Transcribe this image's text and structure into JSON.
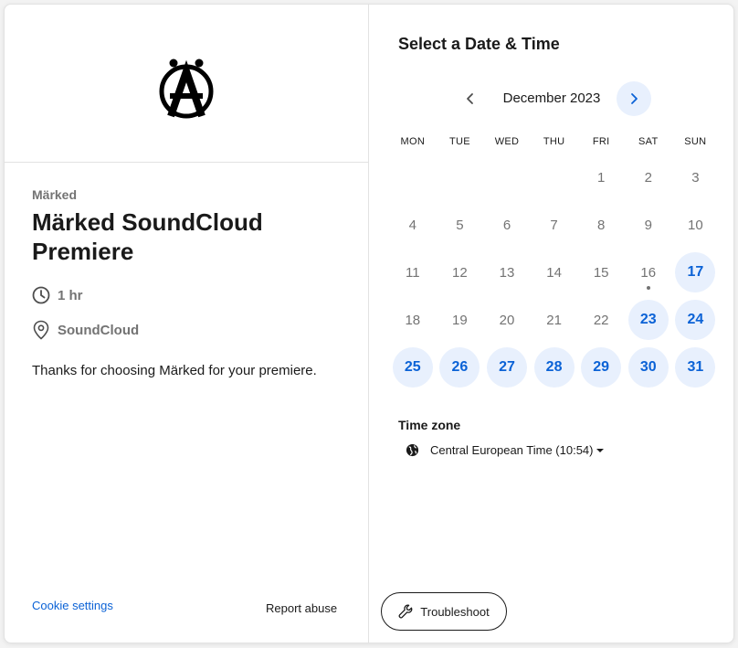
{
  "event": {
    "organizer": "Märked",
    "title": "Märked SoundCloud Premiere",
    "duration": "1 hr",
    "location": "SoundCloud",
    "description": "Thanks for choosing Märked for your premiere."
  },
  "footer": {
    "cookie_settings": "Cookie settings",
    "report_abuse": "Report abuse",
    "troubleshoot": "Troubleshoot"
  },
  "calendar": {
    "heading": "Select a Date & Time",
    "month": "December 2023",
    "weekdays": [
      "MON",
      "TUE",
      "WED",
      "THU",
      "FRI",
      "SAT",
      "SUN"
    ],
    "leading_blanks": 4,
    "days_in_month": 31,
    "today": 16,
    "available_days": [
      17,
      23,
      24,
      25,
      26,
      27,
      28,
      29,
      30,
      31
    ]
  },
  "timezone": {
    "label": "Time zone",
    "value": "Central European Time (10:54)"
  },
  "icons": {
    "logo": "marked-logo-icon",
    "clock": "clock-icon",
    "location": "location-pin-icon",
    "globe": "globe-icon",
    "wrench": "wrench-icon",
    "prev": "chevron-left-icon",
    "next": "chevron-right-icon"
  },
  "colors": {
    "accent": "#0b62d6",
    "available_bg": "#e8f0fd",
    "muted_text": "#737373"
  }
}
